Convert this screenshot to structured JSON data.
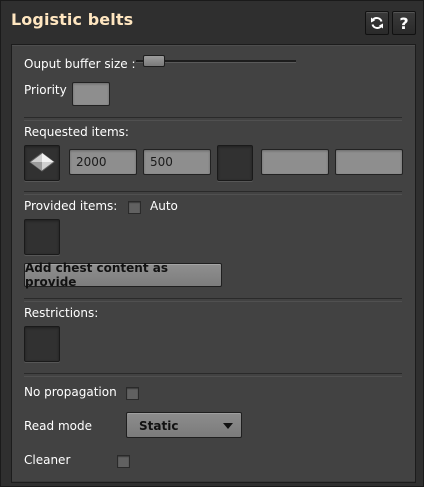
{
  "window": {
    "title": "Logistic belts",
    "refresh_icon": "refresh-icon",
    "help_label": "?"
  },
  "buffer": {
    "label": "Ouput buffer size :",
    "value": 0.05
  },
  "priority": {
    "label": "Priority"
  },
  "requested": {
    "label": "Requested items:",
    "item_icon": "belt-item-icon",
    "fields": [
      "2000",
      "500"
    ]
  },
  "provided": {
    "label": "Provided items:",
    "auto_label": "Auto",
    "auto_checked": false,
    "add_button": "Add chest content as provide"
  },
  "restrictions": {
    "label": "Restrictions:"
  },
  "options": {
    "no_propagation_label": "No propagation",
    "no_propagation_checked": false,
    "read_mode_label": "Read mode",
    "read_mode_value": "Static",
    "cleaner_label": "Cleaner",
    "cleaner_checked": false
  },
  "colors": {
    "title": "#ffe6c0",
    "panel": "#424242",
    "frame": "#2f2f2f"
  }
}
